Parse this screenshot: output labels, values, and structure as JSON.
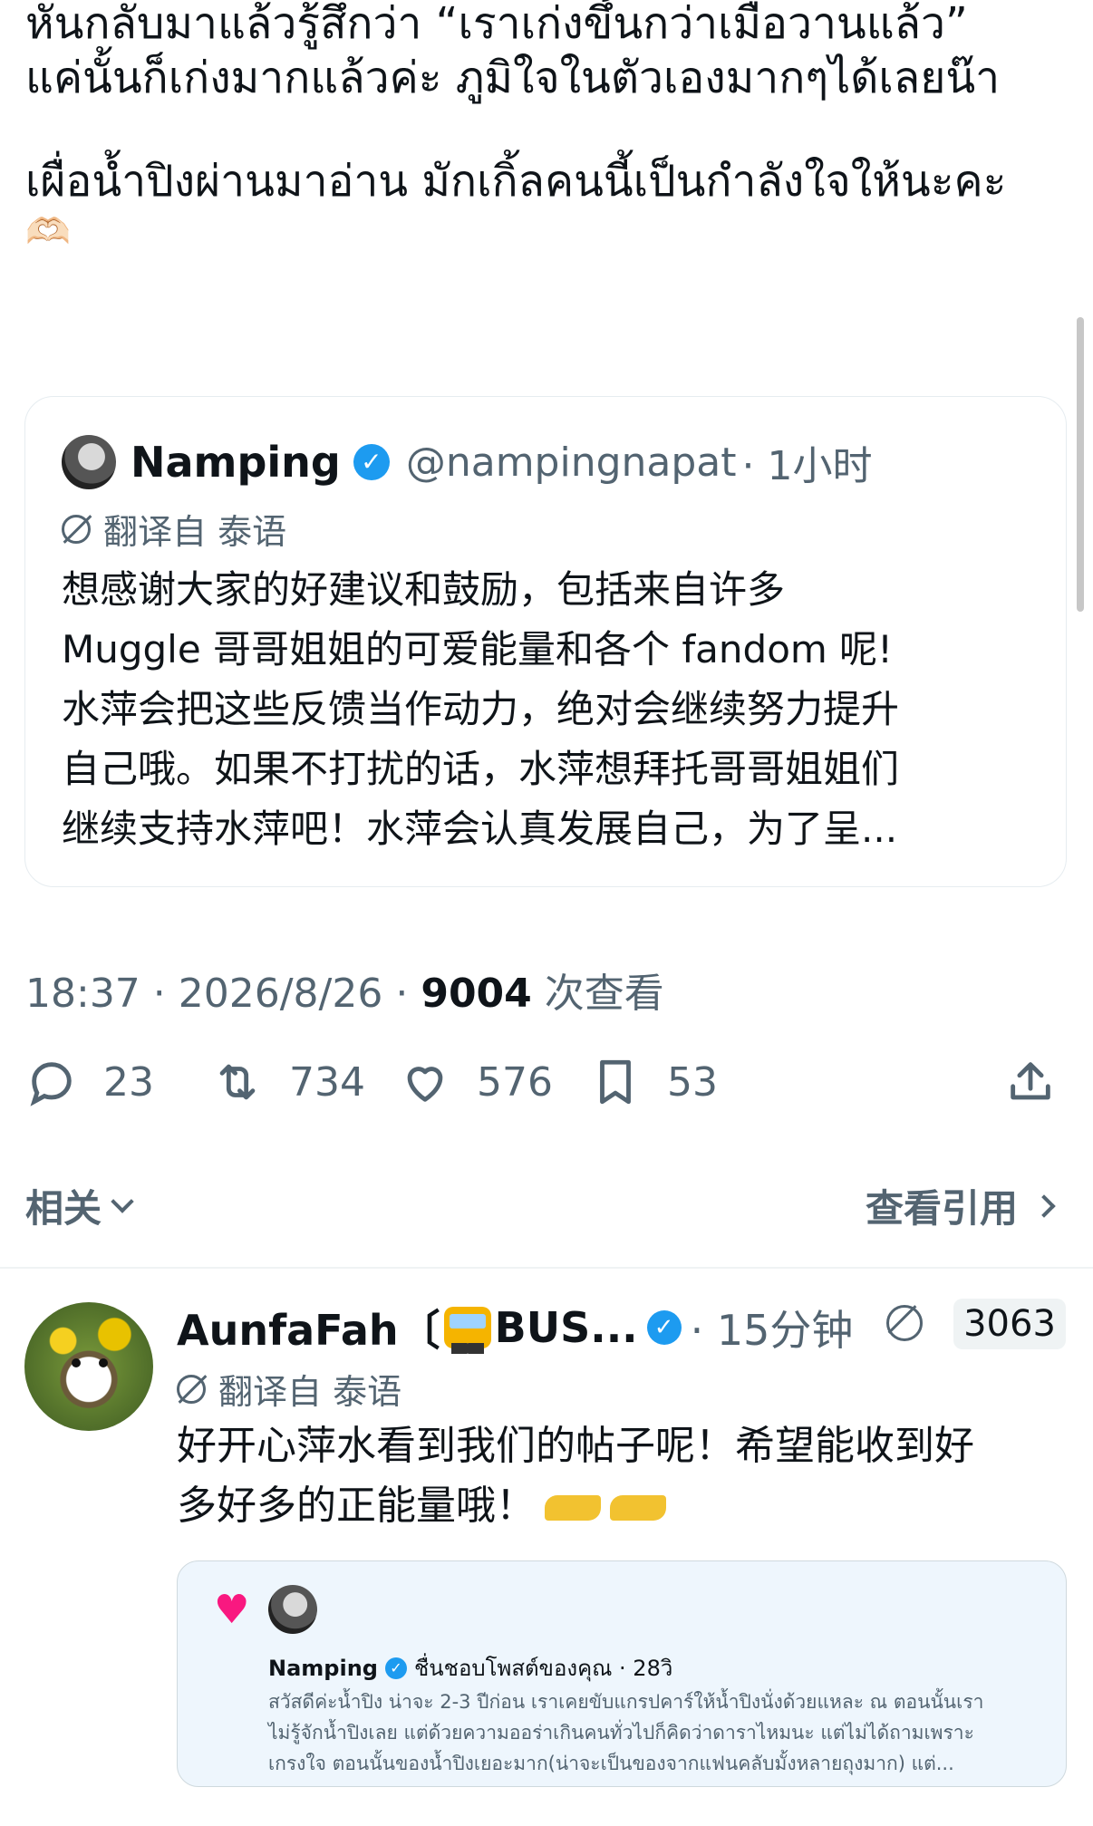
{
  "post": {
    "lines": [
      "หันกลับมาแล้วรู้สึกว่า “เราเก่งขึ้นกว่าเมื่อวานแล้ว”",
      "แค่นั้นก็เก่งมากแล้วค่ะ ภูมิใจในตัวเองมากๆได้เลยน๊า",
      "เผื่อน้ำปิงผ่านมาอ่าน มักเกิ้ลคนนี้เป็นกำลังใจให้นะคะ",
      "🫶🏻"
    ]
  },
  "quoted": {
    "name": "Namping",
    "handle": "@nampingnapat",
    "time": "· 1小时",
    "translated_label": "翻译自 泰语",
    "text_lines": [
      "想感谢大家的好建议和鼓励，包括来自许多",
      "Muggle 哥哥姐姐的可爱能量和各个 fandom 呢!",
      "水萍会把这些反馈当作动力，绝对会继续努力提升",
      "自己哦。如果不打扰的话，水萍想拜托哥哥姐姐们",
      "继续支持水萍吧！水萍会认真发展自己，为了呈..."
    ]
  },
  "meta": {
    "time": "18:37 · 2026/8/26 · ",
    "views": "9004",
    "views_label": " 次查看"
  },
  "actions": {
    "replies": "23",
    "retweets": "734",
    "likes": "576",
    "bookmarks": "53"
  },
  "related": {
    "label": "相关",
    "view_quotes": "查看引用"
  },
  "reply": {
    "name": "AunfaFah〔",
    "name_suffix": "BUS...",
    "time": "· 15分钟",
    "quote_count": "3063",
    "translated_label": "翻译自 泰语",
    "text_lines": [
      "好开心萍水看到我们的帖子呢！希望能收到好",
      "多好多的正能量哦！"
    ],
    "embed": {
      "name": "Namping",
      "meta": "ชื่นชอบโพสต์ของคุณ · 28วิ",
      "lines": [
        "สวัสดีค่ะน้ำปิง น่าจะ 2-3 ปีก่อน เราเคยขับแกรปคาร์ให้น้ำปิงนั่งด้วยแหละ ณ ตอนนั้นเรา",
        "ไม่รู้จักน้ำปิงเลย แต่ด้วยความออร่าเกินคนทั่วไปก็คิดว่าดาราไหมนะ แต่ไม่ได้ถามเพราะ",
        "เกรงใจ ตอนนั้นของน้ำปิงเยอะมาก(น่าจะเป็นของจากแฟนคลับมั้งหลายถุงมาก) แต่..."
      ]
    }
  }
}
